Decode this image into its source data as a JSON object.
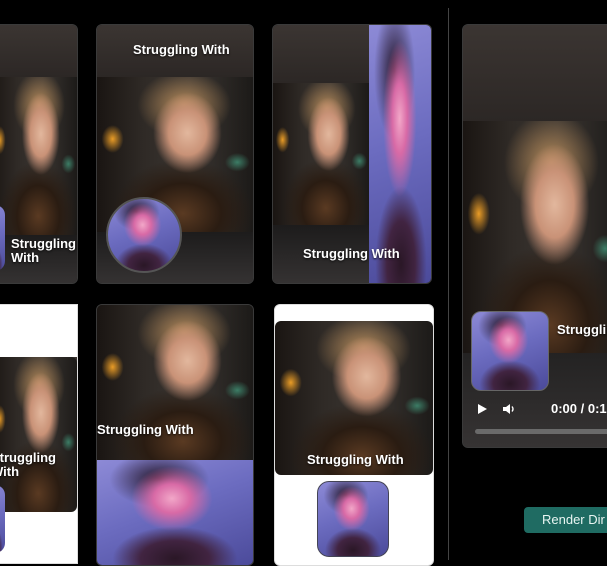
{
  "caption_text": "Struggling With",
  "player": {
    "time_display": "0:00 / 0:1",
    "play_icon": "play-icon",
    "volume_icon": "volume-icon"
  },
  "render_button": {
    "label": "Render Dir"
  },
  "colors": {
    "background": "#000000",
    "accent": "#1f6b62",
    "selfie_bg": "#7b78c8"
  }
}
